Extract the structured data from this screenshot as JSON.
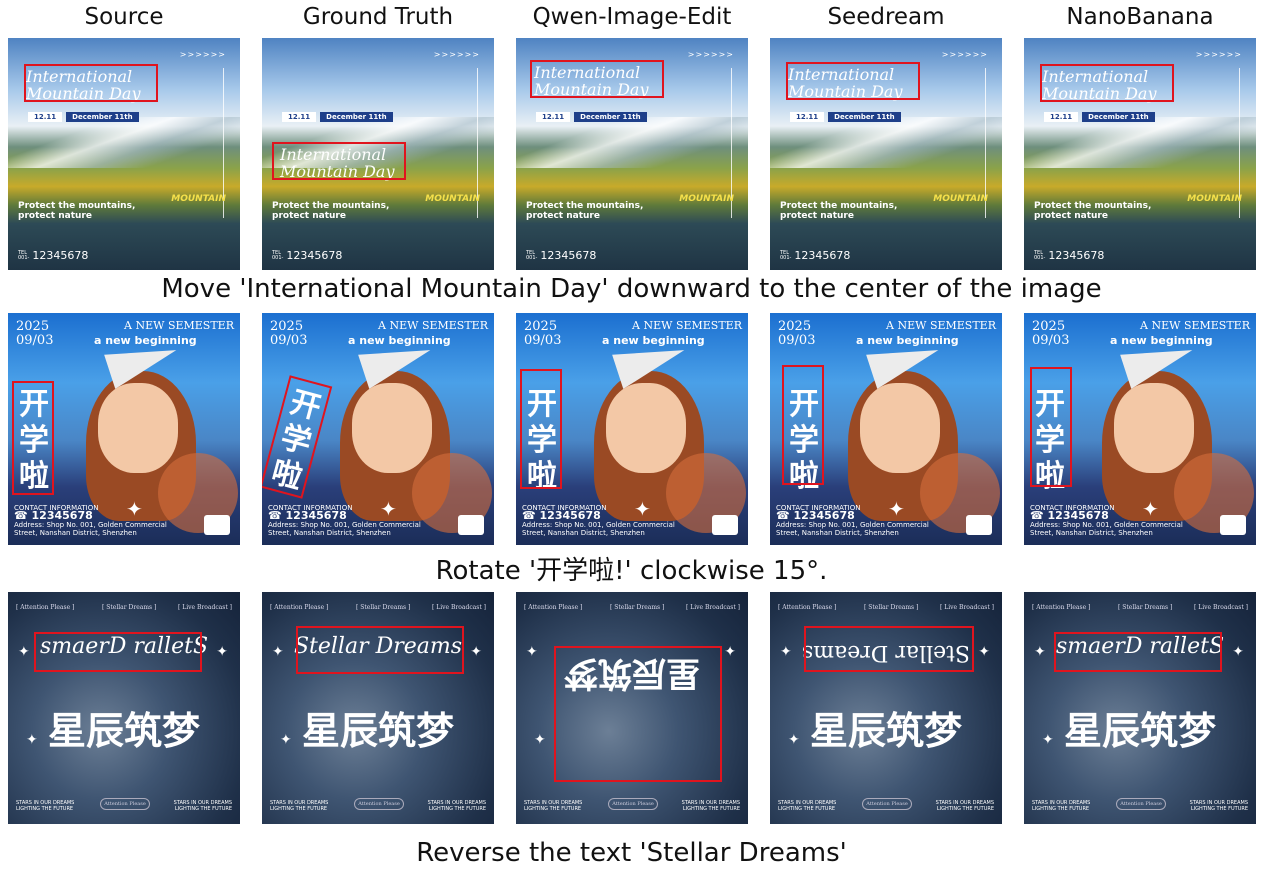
{
  "column_headers": [
    "Source",
    "Ground Truth",
    "Qwen-Image-Edit",
    "Seedream",
    "NanoBanana"
  ],
  "rows": [
    {
      "caption": "Move 'International Mountain Day' downward to the center of the image",
      "poster": {
        "chevrons": ">>>>>>",
        "title_line1": "International",
        "title_line2": "Mountain Day",
        "date_short": "12.11",
        "date_long": "December 11th",
        "slogan_line1": "Protect the mountains,",
        "slogan_line2": "protect nature",
        "mountain_word": "MOUNTAIN",
        "tel_label_1": "TEL",
        "tel_label_2": "001-",
        "tel_number": "12345678"
      }
    },
    {
      "caption": "Rotate '开学啦!' clockwise 15°.",
      "poster": {
        "year": "2025",
        "date": "09/03",
        "semester": "A NEW SEMESTER",
        "beginning": "a new beginning",
        "cn_text": [
          "开",
          "学",
          "啦"
        ],
        "contact_label": "CONTACT INFORMATION",
        "phone": "12345678",
        "address_line1": "Address: Shop No. 001, Golden Commercial",
        "address_line2": "Street, Nanshan District, Shenzhen"
      }
    },
    {
      "caption": "Reverse the text 'Stellar Dreams'",
      "poster": {
        "top_left": "[ Attention Please ]",
        "top_center": "[ Stellar Dreams ]",
        "top_right": "[ Live Broadcast ]",
        "title_en": "Stellar Dreams",
        "title_en_reversed": "smaerD ralletS",
        "title_cn": "星辰筑梦",
        "bottom_left_1": "STARS IN OUR DREAMS",
        "bottom_left_2": "LIGHTING THE FUTURE",
        "bottom_center": "Attention Please",
        "bottom_right_1": "STARS IN OUR DREAMS",
        "bottom_right_2": "LIGHTING THE FUTURE"
      }
    }
  ],
  "colors": {
    "highlight_box": "#e0141e",
    "date_blue": "#1e3f8a",
    "mountain_word": "#f5e04a"
  }
}
